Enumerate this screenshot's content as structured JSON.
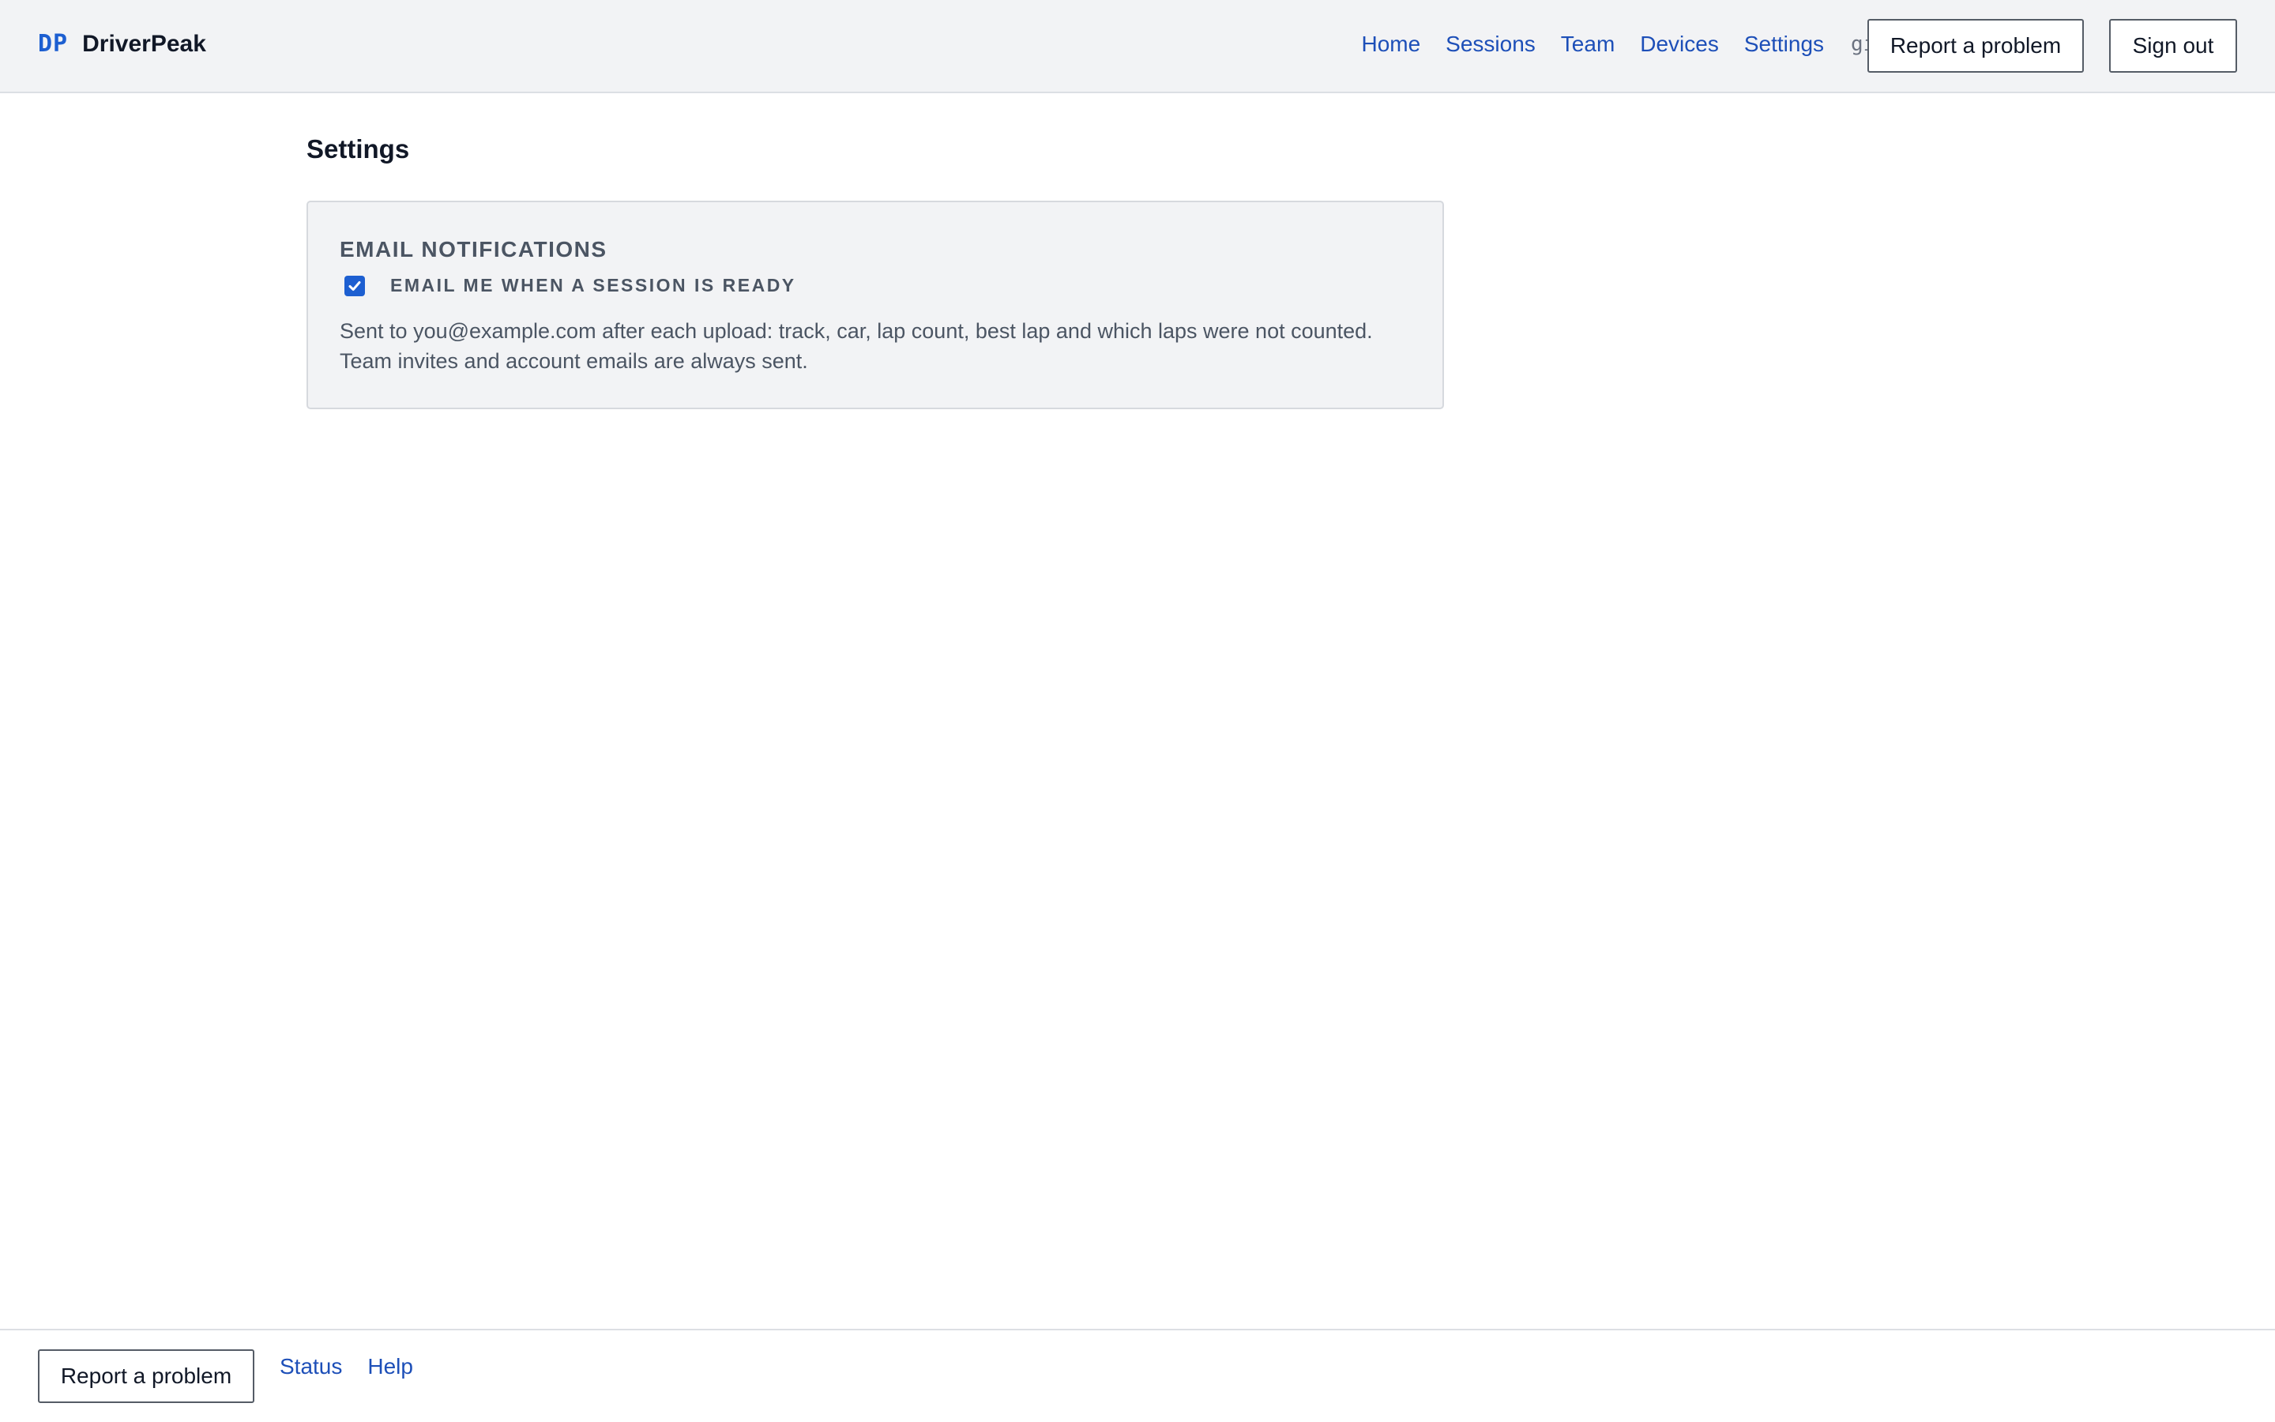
{
  "brand": {
    "mark": "DP",
    "name": "DriverPeak"
  },
  "nav": {
    "items": [
      {
        "label": "Home"
      },
      {
        "label": "Sessions"
      },
      {
        "label": "Team"
      },
      {
        "label": "Devices"
      },
      {
        "label": "Settings"
      }
    ],
    "username": "gil",
    "report_label": "Report a problem",
    "signout_label": "Sign out"
  },
  "page": {
    "title": "Settings"
  },
  "email_notifications": {
    "heading": "EMAIL NOTIFICATIONS",
    "session_ready": {
      "label": "EMAIL ME WHEN A SESSION IS READY",
      "checked": true
    },
    "description": "Sent to you@example.com after each upload: track, car, lap count, best lap and which laps were not counted. Team invites and account emails are always sent."
  },
  "footer": {
    "report_label": "Report a problem",
    "links": [
      {
        "label": "Status"
      },
      {
        "label": "Help"
      }
    ]
  },
  "colors": {
    "accent": "#1d5fd1",
    "link": "#1d4fb8",
    "header_bg": "#f2f3f5",
    "muted_text": "#4b5563"
  }
}
